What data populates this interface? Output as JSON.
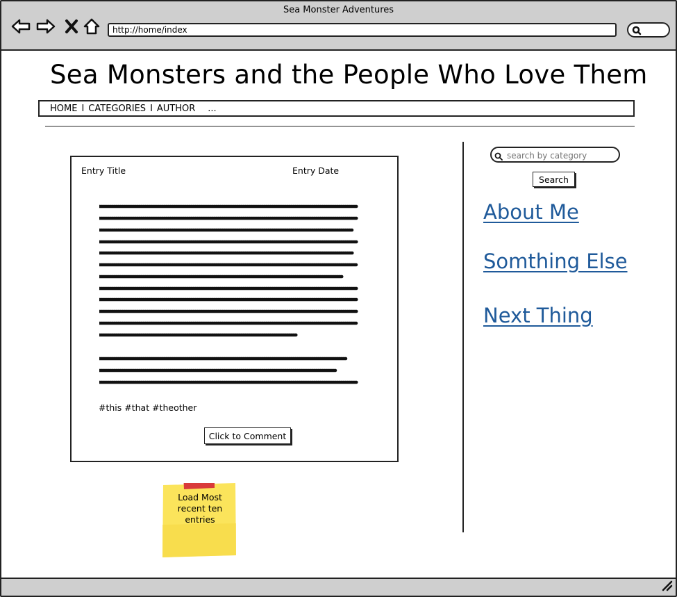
{
  "window": {
    "title": "Sea Monster Adventures",
    "url": "http://home/index"
  },
  "toolbar": {
    "icons": [
      "back-arrow-icon",
      "forward-arrow-icon",
      "close-x-icon",
      "home-icon",
      "search-icon"
    ]
  },
  "page": {
    "site_title": "Sea Monsters and the People Who Love Them",
    "nav": {
      "items": [
        "HOME",
        "CATEGORIES",
        "AUTHOR"
      ],
      "separator": "I",
      "more": "..."
    }
  },
  "entry": {
    "title_label": "Entry Title",
    "date_label": "Entry Date",
    "tags": "#this #that #theother",
    "comment_button": "Click to Comment"
  },
  "sticky_note": {
    "text": "Load Most recent ten entries",
    "color": "#fbe45b",
    "tape_color": "#d93a3a"
  },
  "sidebar": {
    "search_placeholder": "search by category",
    "search_button": "Search",
    "links": [
      "About Me",
      "Somthing Else",
      "Next Thing"
    ],
    "link_color": "#1f5a9a"
  },
  "colors": {
    "chrome": "#cfcfcf",
    "border": "#222222"
  }
}
